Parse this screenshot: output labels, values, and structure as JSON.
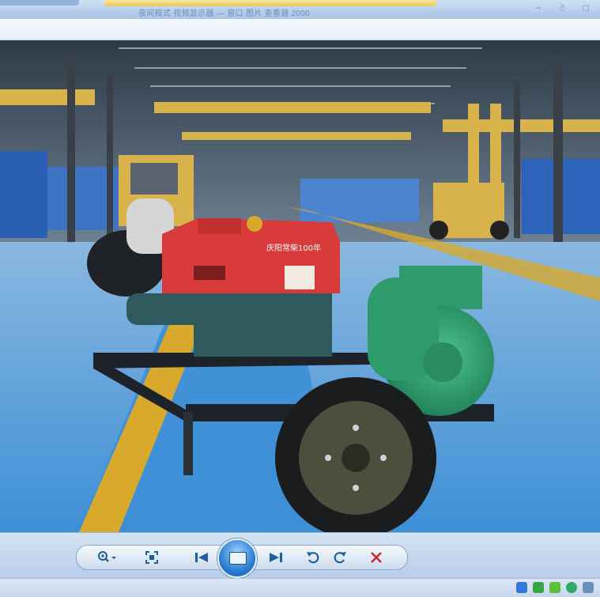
{
  "window": {
    "title_text": "夜间模式 视频显示器 — 窗口 图片 查看器 2000",
    "buttons": [
      "−",
      "☃",
      "□"
    ]
  },
  "photo": {
    "engine_label": "庆阳常柴100年",
    "colors": {
      "engine_red": "#d93a3a",
      "generator_green": "#2f9a6c",
      "floor_blue": "#3d8fd6",
      "stripe_yellow": "#d8a92c",
      "forklift_yellow": "#d8b24a"
    }
  },
  "controls": {
    "zoom": "zoom-icon",
    "fit": "fit-window-icon",
    "previous": "previous-icon",
    "slideshow": "slideshow-icon",
    "next": "next-icon",
    "rotate_ccw": "rotate-counterclockwise-icon",
    "rotate_cw": "rotate-clockwise-icon",
    "delete": "delete-icon"
  },
  "tray": [
    "paw-icon",
    "shield-icon",
    "shield-check-icon",
    "globe-icon",
    "network-icon"
  ]
}
